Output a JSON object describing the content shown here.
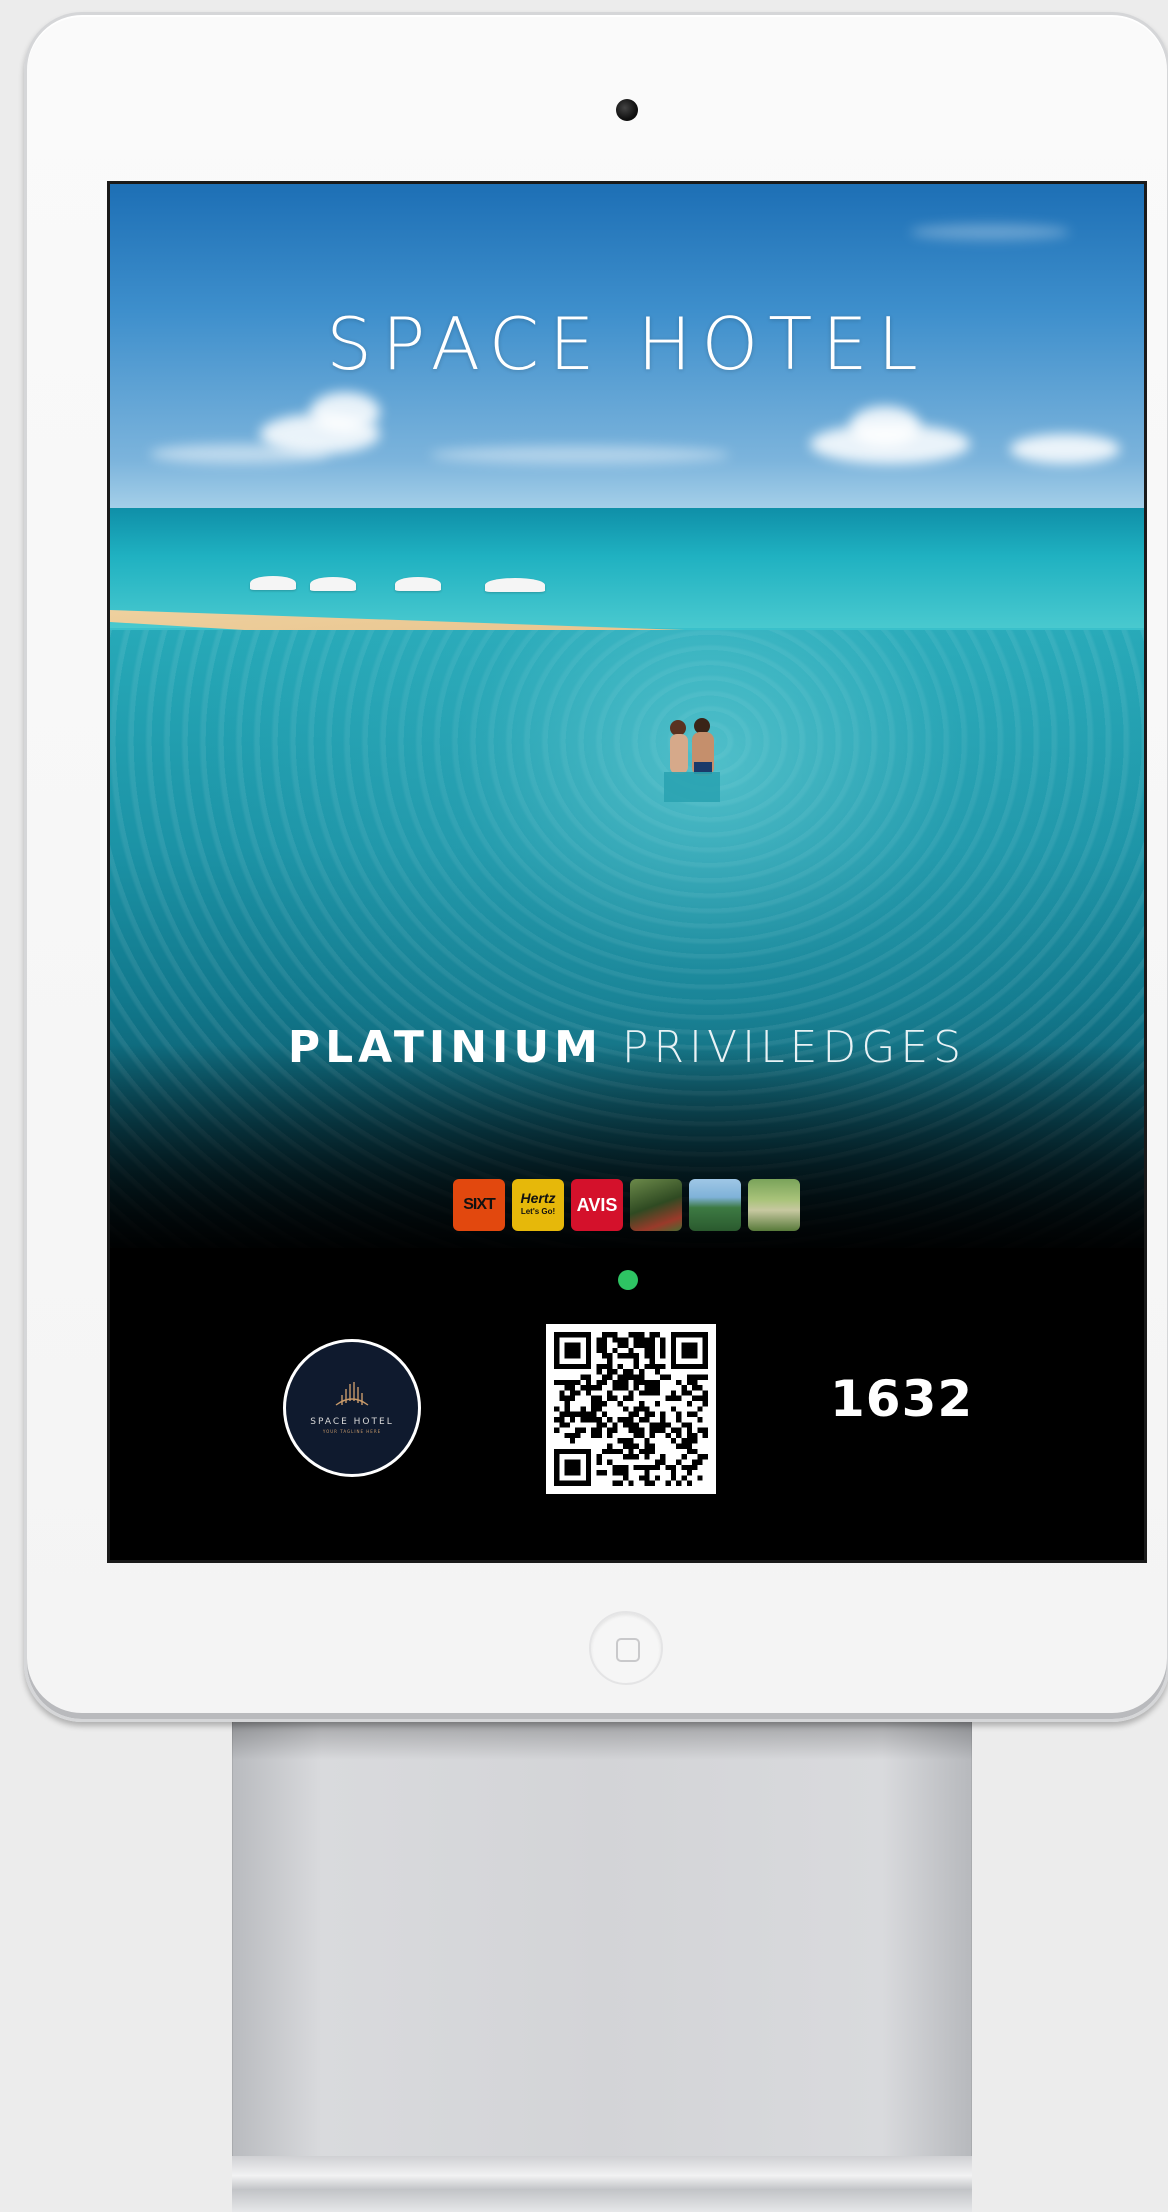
{
  "hotel": {
    "title": "SPACE HOTEL",
    "tagline_strong": "PLATINIUM",
    "tagline_light": "PRIVILEDGES"
  },
  "partners": [
    {
      "name": "sixt",
      "label": "SIXT",
      "color": "#e2480e"
    },
    {
      "name": "hertz",
      "label": "Hertz",
      "sublabel": "Let's Go!",
      "color": "#e6b80a"
    },
    {
      "name": "avis",
      "label": "AVIS",
      "color": "#d4112b"
    },
    {
      "name": "waterfall-photo",
      "icon": "waterfall-photo"
    },
    {
      "name": "volcano-photo",
      "icon": "volcano-photo"
    },
    {
      "name": "bridge-photo",
      "icon": "bridge-photo"
    }
  ],
  "status": {
    "color": "#2ec463"
  },
  "badge": {
    "text": "SPACE HOTEL",
    "subtext": "YOUR TAGLINE HERE"
  },
  "code": {
    "number": "1632"
  }
}
